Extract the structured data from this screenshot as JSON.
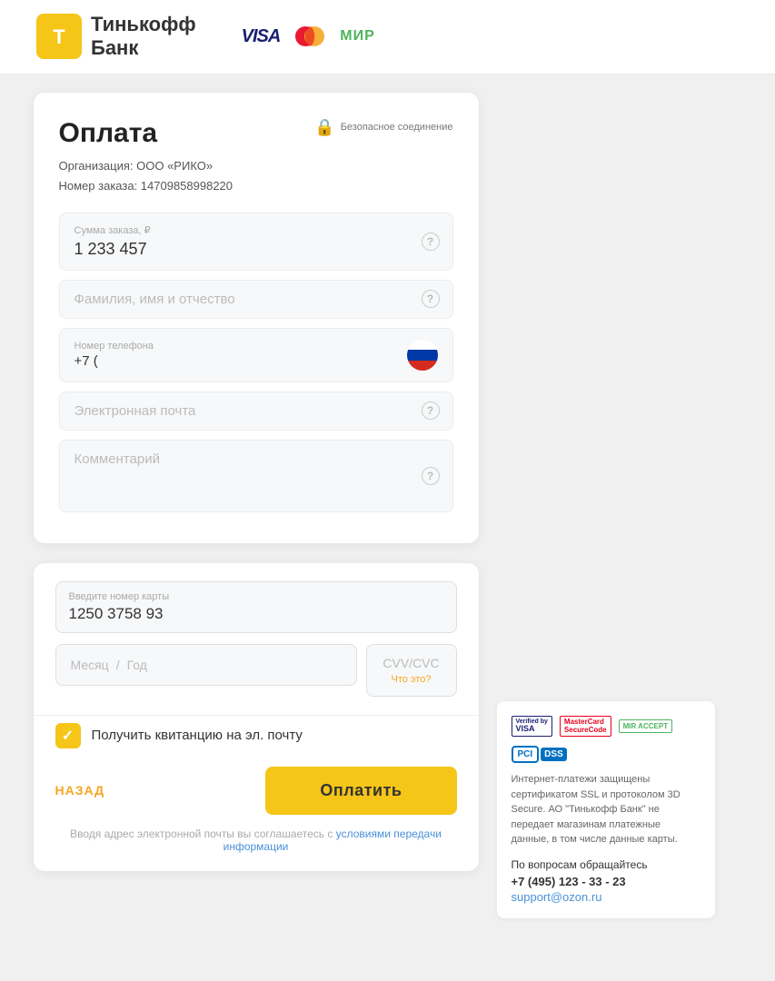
{
  "header": {
    "bank_name_line1": "Тинькофф",
    "bank_name_line2": "Банк",
    "visa_label": "VISA",
    "mir_label": "МИР"
  },
  "form": {
    "title": "Оплата",
    "secure_label": "Безопасное соединение",
    "org_label": "Организация: ООО «РИКО»",
    "order_label": "Номер заказа: 14709858998220",
    "amount_field_label": "Сумма заказа, ₽",
    "amount_value": "1 233 457",
    "name_placeholder": "Фамилия, имя и отчество",
    "phone_label": "Номер телефона",
    "phone_value": "+7 (",
    "email_placeholder": "Электронная почта",
    "comment_placeholder": "Комментарий"
  },
  "card": {
    "card_number_label": "Введите номер карты",
    "card_number_value": "1250  3758  93",
    "month_placeholder": "Месяц",
    "year_placeholder": "Год",
    "cvv_label": "CVV/CVC",
    "cvv_hint": "Что это?"
  },
  "receipt": {
    "label": "Получить квитанцию на эл. почту"
  },
  "actions": {
    "back_label": "НАЗАД",
    "pay_label": "Оплатить"
  },
  "terms": {
    "prefix": "Вводя адрес электронной почты вы соглашаетесь с ",
    "link_text": "условиями передачи информации"
  },
  "security": {
    "verified_visa_line1": "Verified by",
    "verified_visa_line2": "VISA",
    "mc_secure_line1": "MasterCard",
    "mc_secure_line2": "SecureCode",
    "mir_accept": "MIR ACCEPT",
    "pci_dss": "PCI DSS",
    "security_text": "Интернет-платежи защищены сертификатом SSL и протоколом 3D Secure. АО \"Тинькофф Банк\" не передает магазинам платежные данные, в том числе данные карты.",
    "contact_title": "По вопросам обращайтесь",
    "phone": "+7 (495) 123 - 33 - 23",
    "email": "support@ozon.ru"
  }
}
